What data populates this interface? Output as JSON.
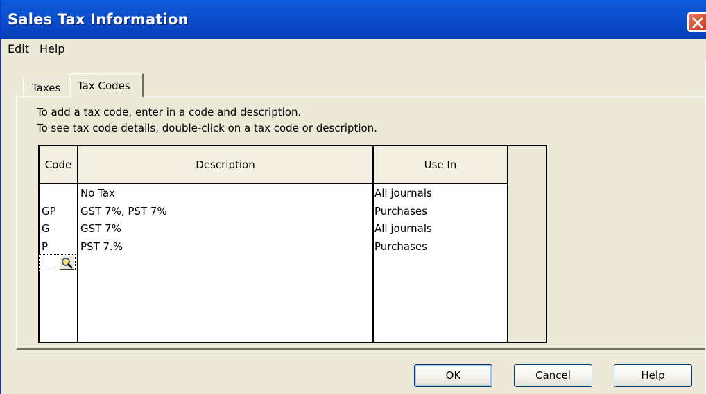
{
  "window": {
    "title": "Sales Tax Information"
  },
  "menu": {
    "items": [
      "Edit",
      "Help"
    ]
  },
  "tabs": [
    {
      "label": "Taxes",
      "active": false
    },
    {
      "label": "Tax Codes",
      "active": true
    }
  ],
  "instructions": [
    "To add a tax code, enter in a code and description.",
    "To see tax code details, double-click on a tax code or description."
  ],
  "table": {
    "headers": {
      "code": "Code",
      "description": "Description",
      "use_in": "Use In"
    },
    "rows": [
      {
        "code": "",
        "description": "No Tax",
        "use_in": "All journals"
      },
      {
        "code": "GP",
        "description": "GST 7%, PST 7%",
        "use_in": "Purchases"
      },
      {
        "code": "G",
        "description": "GST 7%",
        "use_in": "All journals"
      },
      {
        "code": "P",
        "description": "PST 7.%",
        "use_in": "Purchases"
      }
    ]
  },
  "buttons": {
    "ok": "OK",
    "cancel": "Cancel",
    "help": "Help"
  },
  "colors": {
    "titlebar": "#0b4dcc",
    "dialog_bg": "#ece9d8",
    "close_button": "#d95a3a"
  }
}
